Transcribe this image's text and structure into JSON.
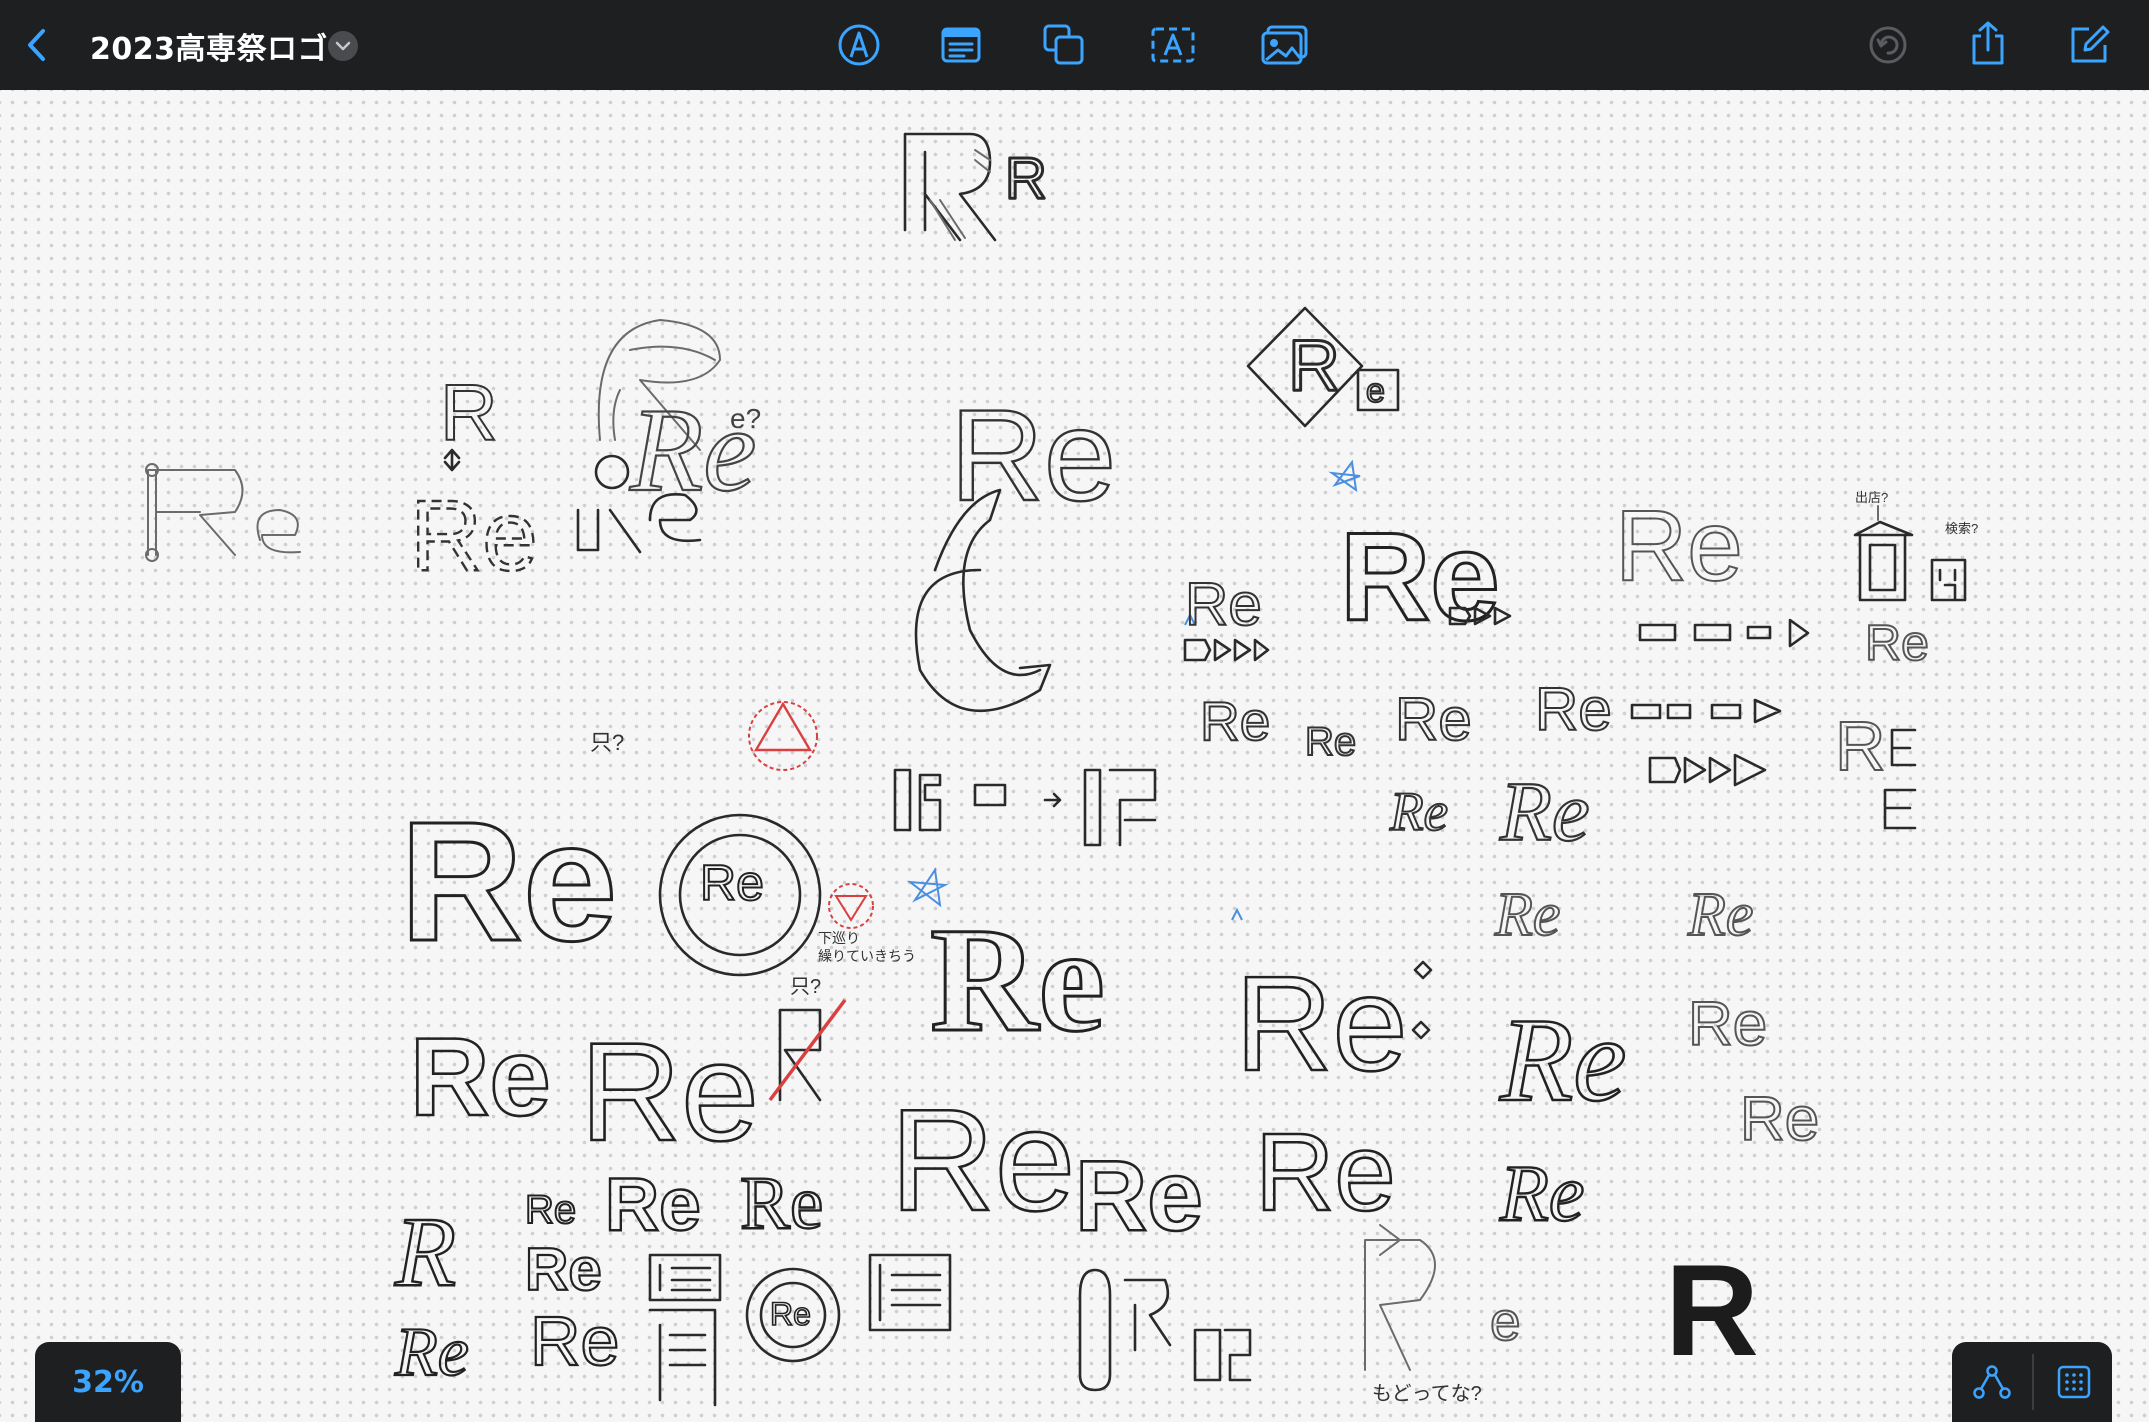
{
  "toolbar": {
    "document_title": "2023高専祭ロゴ",
    "icons": {
      "back": "chevron-left-icon",
      "title_menu": "chevron-down-icon",
      "pen": "pen-tool-icon",
      "text_block": "text-block-icon",
      "shapes": "shapes-icon",
      "text_box": "text-box-icon",
      "media": "media-icon",
      "undo": "undo-icon",
      "share": "share-icon",
      "compose": "compose-icon"
    }
  },
  "canvas": {
    "sketch_labels": {
      "re": "Re",
      "r": "R",
      "e": "e",
      "e_question": "e?",
      "mi_question": "只?",
      "mi_question2": "只?",
      "shutten": "出店?",
      "kensaku": "検索?",
      "kudari": "下巡り",
      "kudari2": "繰りていきちう",
      "modotte": "もどってな?"
    }
  },
  "footer": {
    "zoom_level": "32%",
    "icons": {
      "nodes": "connector-nodes-icon",
      "grid": "grid-icon"
    }
  },
  "colors": {
    "toolbar_bg": "#1e1f21",
    "accent": "#3aa4ff",
    "canvas_bg": "#f6f6f7",
    "ink": "#2a2a2a",
    "red_ink": "#d94040",
    "blue_ink": "#4a8fe0"
  }
}
